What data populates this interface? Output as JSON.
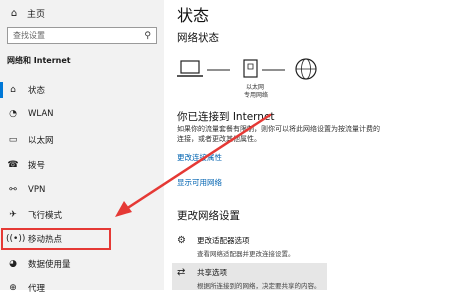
{
  "sidebar": {
    "home_label": "主页",
    "search_placeholder": "查找设置",
    "section_title": "网络和 Internet",
    "items": [
      {
        "label": "状态",
        "icon": "home-network-icon",
        "active": true
      },
      {
        "label": "WLAN",
        "icon": "wifi-icon"
      },
      {
        "label": "以太网",
        "icon": "ethernet-icon"
      },
      {
        "label": "拨号",
        "icon": "dialup-icon"
      },
      {
        "label": "VPN",
        "icon": "vpn-icon"
      },
      {
        "label": "飞行模式",
        "icon": "airplane-icon"
      },
      {
        "label": "移动热点",
        "icon": "hotspot-icon"
      },
      {
        "label": "数据使用量",
        "icon": "data-usage-icon"
      },
      {
        "label": "代理",
        "icon": "proxy-icon"
      }
    ]
  },
  "main": {
    "page_title": "状态",
    "network_status_title": "网络状态",
    "adapter_caption_1": "以太网",
    "adapter_caption_2": "专用网络",
    "connected_title": "你已连接到 Internet",
    "desc_line1": "如果你的流量套餐有限制，则你可以将此网络设置为按流量计费的",
    "desc_line2": "连接，或者更改其他属性。",
    "link_change_props": "更改连接属性",
    "link_show_networks": "显示可用网络",
    "change_settings_title": "更改网络设置",
    "adapter_option_title": "更改适配器选项",
    "adapter_option_sub": "查看网络适配器并更改连接设置。",
    "sharing_option_title": "共享选项",
    "sharing_option_sub": "根据所连接到的网络，决定要共享的内容。"
  },
  "colors": {
    "accent": "#0078d7",
    "link": "#0063b1",
    "annotation": "#e53935"
  }
}
